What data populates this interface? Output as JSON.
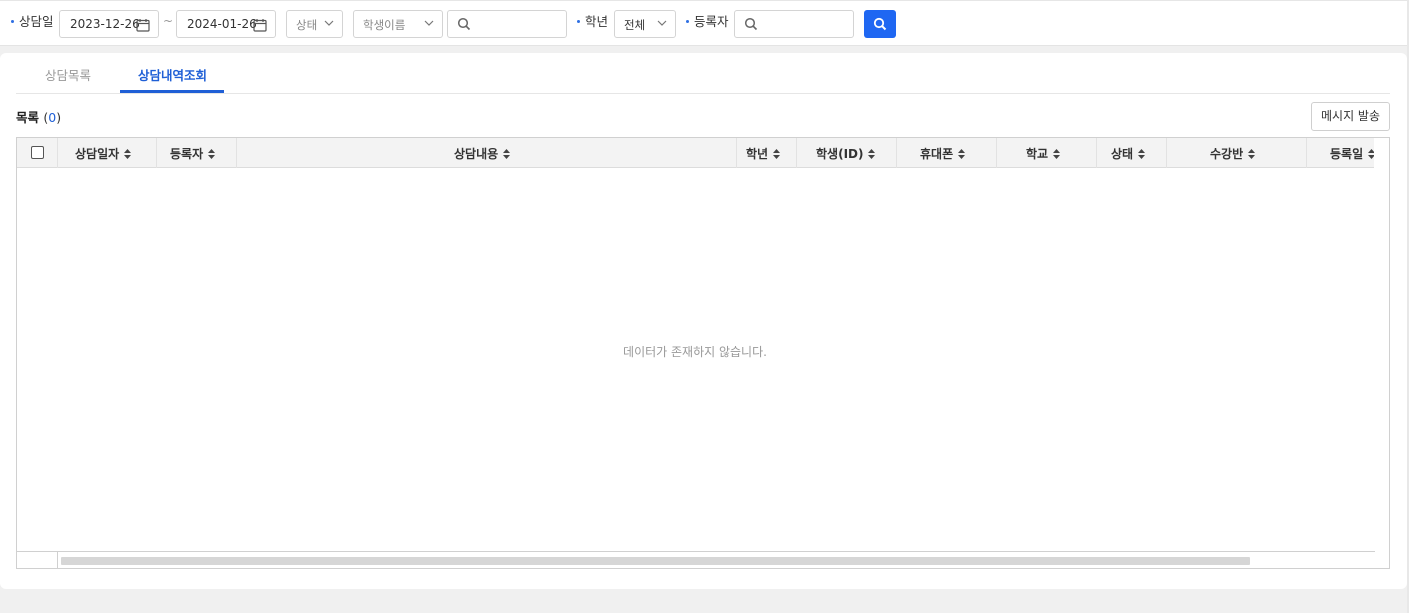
{
  "filters": {
    "consult_date_label": "상담일",
    "date_from": "2023-12-26",
    "date_to": "2024-01-26",
    "status_placeholder": "상태",
    "student_select_placeholder": "학생이름",
    "search_value": "",
    "grade_label": "학년",
    "grade_value": "전체",
    "registrant_label": "등록자",
    "registrant_search_value": "",
    "date_separator": "~"
  },
  "tabs": [
    {
      "label": "상담목록",
      "active": false
    },
    {
      "label": "상담내역조회",
      "active": true
    }
  ],
  "list": {
    "title": "목록",
    "count": "0",
    "send_message_label": "메시지 발송",
    "columns": [
      "상담일자",
      "등록자",
      "상담내용",
      "학년",
      "학생(ID)",
      "휴대폰",
      "학교",
      "상태",
      "수강반",
      "등록일"
    ],
    "empty_message": "데이터가 존재하지 않습니다."
  },
  "colors": {
    "accent": "#1f67f2",
    "tab_active": "#1f5fd6",
    "header_bg": "#f3f3f3"
  }
}
